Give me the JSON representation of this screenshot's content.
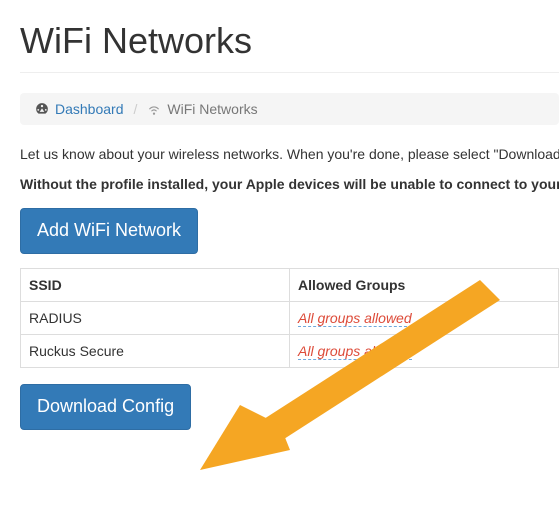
{
  "page": {
    "title": "WiFi Networks"
  },
  "breadcrumb": {
    "dashboard_label": "Dashboard",
    "current_label": "WiFi Networks",
    "sep": "/"
  },
  "intro": {
    "text": "Let us know about your wireless networks. When you're done, please select \"Download",
    "warning": "Without the profile installed, your Apple devices will be unable to connect to your"
  },
  "buttons": {
    "add_label": "Add WiFi Network",
    "download_label": "Download Config"
  },
  "table": {
    "headers": {
      "ssid": "SSID",
      "groups": "Allowed Groups"
    },
    "rows": [
      {
        "ssid": "RADIUS",
        "groups": "All groups allowed"
      },
      {
        "ssid": "Ruckus Secure",
        "groups": "All groups allowed"
      }
    ]
  },
  "annotation": {
    "arrow_color": "#f5a623"
  }
}
